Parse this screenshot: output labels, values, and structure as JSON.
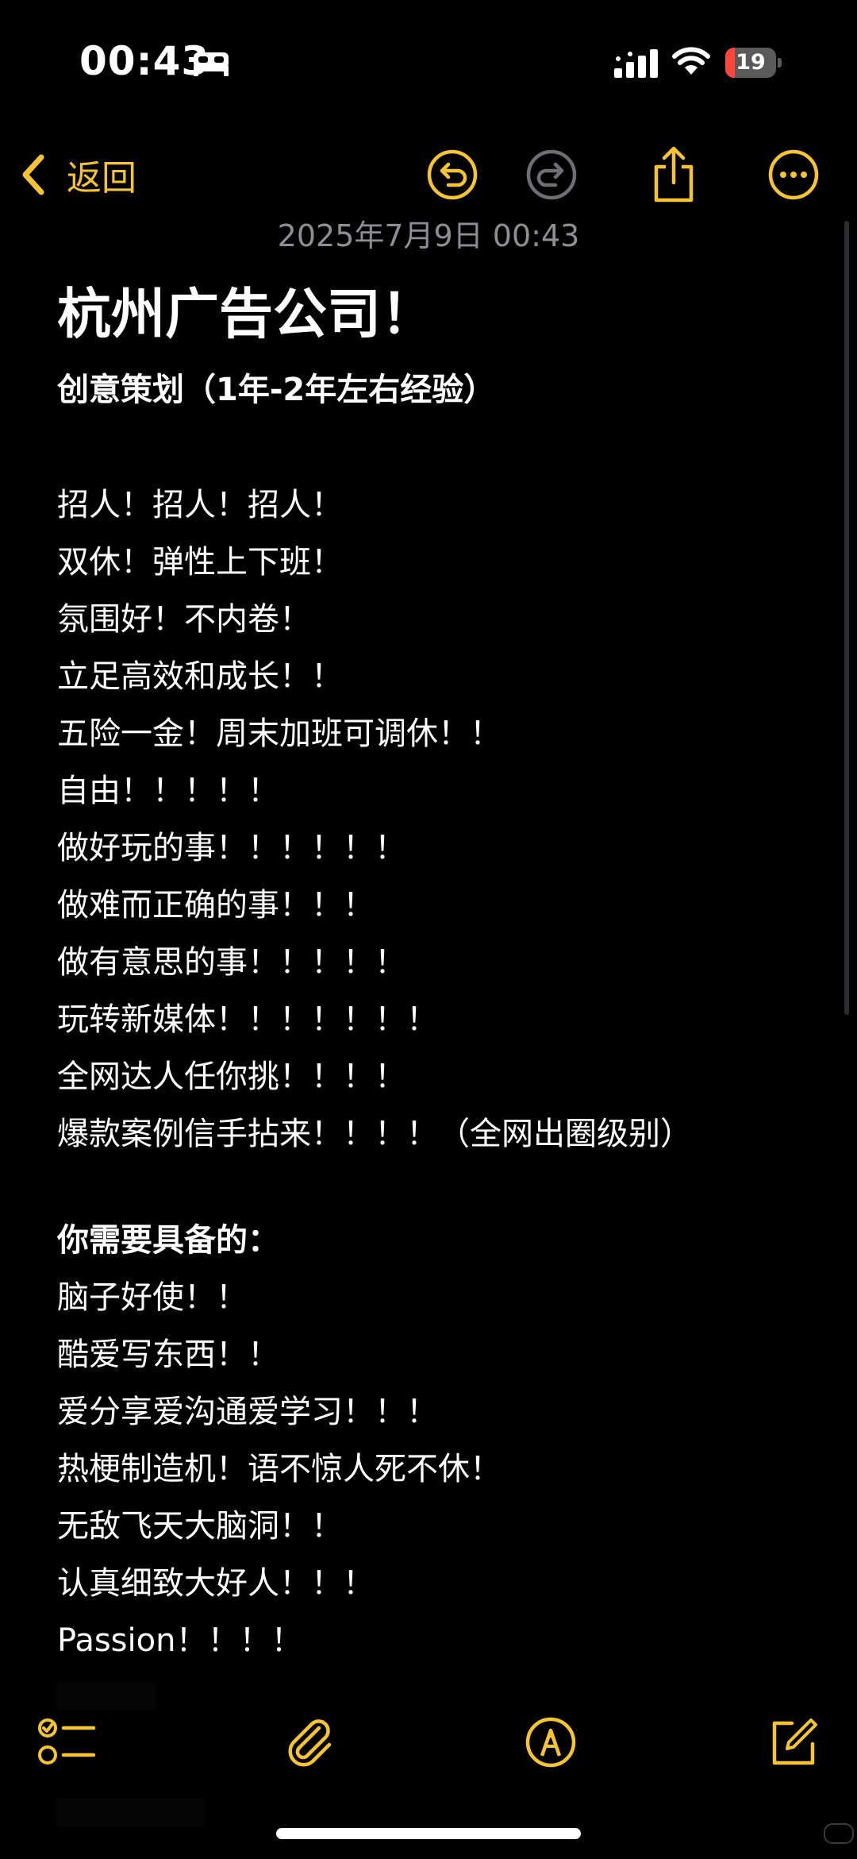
{
  "status_bar": {
    "time": "00:43",
    "battery_level": "19",
    "battery_percent": 19,
    "icons": [
      "bed-icon",
      "signal-icon",
      "wifi-icon",
      "battery-icon"
    ]
  },
  "nav": {
    "back_label": "返回",
    "icons": [
      "back-chevron-icon",
      "undo-icon",
      "redo-icon",
      "share-icon",
      "more-icon"
    ]
  },
  "note": {
    "date": "2025年7月9日 00:43",
    "title": "杭州广告公司！",
    "subtitle": "创意策划（1年-2年左右经验）",
    "lines": [
      "招人！招人！招人！",
      "双休！弹性上下班！",
      "氛围好！不内卷！",
      "立足高效和成长！！",
      "五险一金！周末加班可调休！！",
      "自由！！！！！",
      "做好玩的事！！！！！！",
      "做难而正确的事！！！",
      "做有意思的事！！！！！",
      "玩转新媒体！！！！！！！",
      "全网达人任你挑！！！！",
      "爆款案例信手拈来！！！！（全网出圈级别）"
    ],
    "requirements_heading": "你需要具备的：",
    "requirements": [
      "脑子好使！！",
      "酷爱写东西！！",
      "爱分享爱沟通爱学习！！！",
      "热梗制造机！语不惊人死不休！",
      "无敌飞天大脑洞！！",
      "认真细致大好人！！！",
      "Passion！！！！"
    ]
  },
  "toolbar": {
    "icons": [
      "checklist-icon",
      "attachment-icon",
      "markup-icon",
      "compose-icon"
    ]
  },
  "colors": {
    "accent": "#f6c431",
    "background": "#000000",
    "text": "#ffffff",
    "secondary_text": "#8e8e93",
    "battery_low": "#ff453a",
    "disabled_icon": "#6e6e73"
  }
}
